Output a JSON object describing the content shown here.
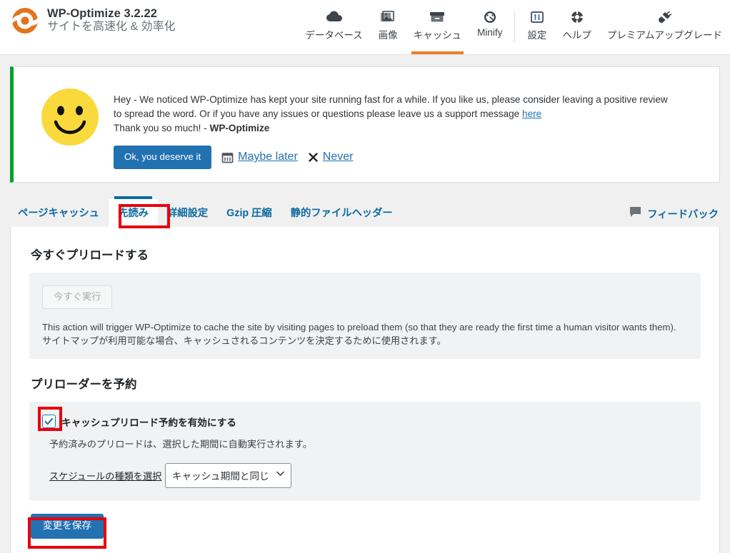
{
  "header": {
    "logo_icon": "wp-optimize-logo-icon",
    "title": "WP-Optimize 3.2.22",
    "subtitle": "サイトを高速化 & 効率化",
    "nav": [
      {
        "label": "データベース",
        "icon": "cloud-icon",
        "active": false
      },
      {
        "label": "画像",
        "icon": "images-icon",
        "active": false
      },
      {
        "label": "キャッシュ",
        "icon": "archive-box-icon",
        "active": true
      },
      {
        "label": "Minify",
        "icon": "gauge-icon",
        "active": false
      },
      {
        "label": "設定",
        "icon": "sliders-icon",
        "active": false
      },
      {
        "label": "ヘルプ",
        "icon": "lifebuoy-icon",
        "active": false
      },
      {
        "label": "プレミアムアップグレード",
        "icon": "plug-icon",
        "active": false
      }
    ],
    "active_accent": "#f07e26"
  },
  "notice": {
    "accent_color": "#00a32a",
    "avatar_icon": "smiley-face-icon",
    "line1_a": "Hey - We noticed WP-Optimize has kept your site running fast for a while. If you like us, please consider leaving a positive review",
    "line2_a": "to spread the word. Or if you have any issues or questions please leave us a support message ",
    "line2_link": "here",
    "line3_a": "Thank you so much! - ",
    "line3_b": "WP-Optimize",
    "ok_button": "Ok, you deserve it",
    "maybe_later": "Maybe later",
    "maybe_later_icon": "calendar-icon",
    "never": "Never",
    "never_icon": "close-x-icon"
  },
  "tabs": {
    "items": [
      {
        "label": "ページキャッシュ",
        "active": false
      },
      {
        "label": "先読み",
        "active": true
      },
      {
        "label": "詳細設定",
        "active": false
      },
      {
        "label": "Gzip 圧縮",
        "active": false
      },
      {
        "label": "静的ファイルヘッダー",
        "active": false
      }
    ],
    "feedback_label": "フィードバック",
    "feedback_icon": "speech-bubble-icon",
    "active_color": "#0b6a9e"
  },
  "main": {
    "preload_now": {
      "title": "今すぐプリロードする",
      "run_button": "今すぐ実行",
      "run_button_disabled": true,
      "description": "This action will trigger WP-Optimize to cache the site by visiting pages to preload them (so that they are ready the first time a human visitor wants them). サイトマップが利用可能な場合、キャッシュされるコンテンツを決定するために使用されます。"
    },
    "schedule": {
      "title": "プリローダーを予約",
      "checkbox_label": "キャッシュプリロード予約を有効にする",
      "checkbox_checked": true,
      "checkbox_icon": "checkmark-icon",
      "sub_text": "予約済みのプリロードは、選択した期間に自動実行されます。",
      "select_label": "スケジュールの種類を選択",
      "select_value": "キャッシュ期間と同じ",
      "select_caret_icon": "chevron-down-icon"
    },
    "save_button": "変更を保存"
  },
  "annotations": {
    "color": "#e8000d",
    "boxes": [
      {
        "name": "tab-preload-highlight"
      },
      {
        "name": "enable-schedule-checkbox-highlight"
      },
      {
        "name": "save-changes-highlight"
      }
    ]
  }
}
